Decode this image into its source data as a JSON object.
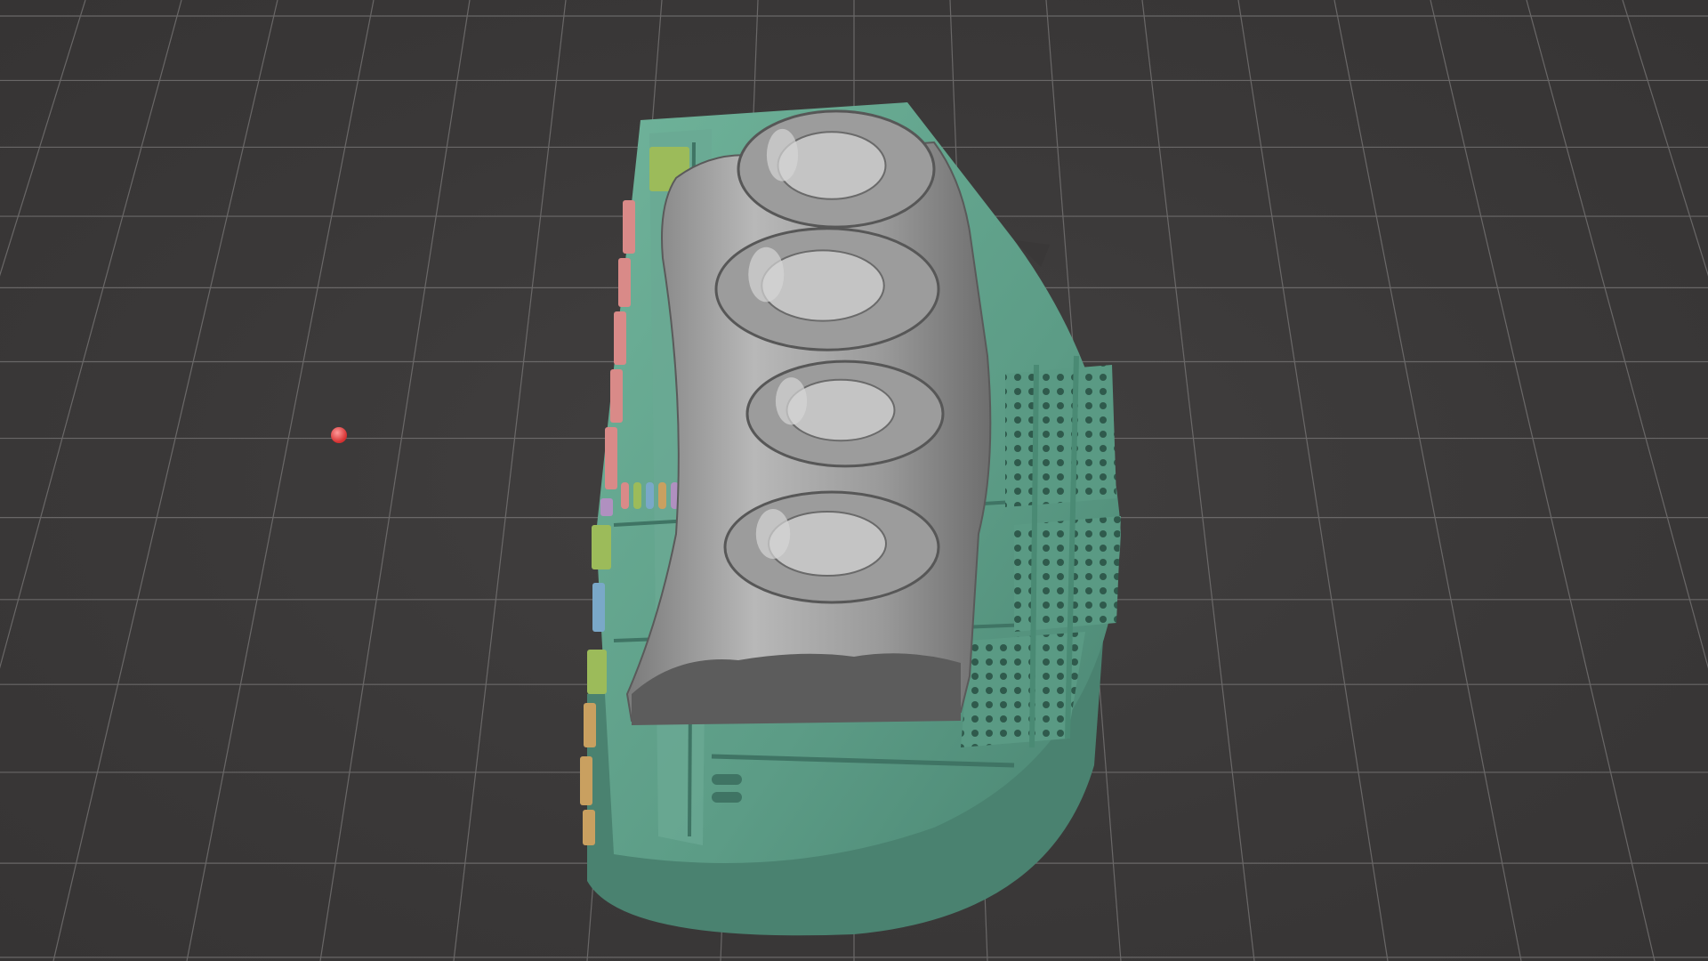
{
  "viewport": {
    "background_color": "#3a3838",
    "grid_color": "#7a7878",
    "grid_visible": true
  },
  "scene": {
    "pivot_marker_color": "#e84040",
    "model_base_color": "#5fa08a",
    "model_base_highlight": "#7cc0a6",
    "model_surface_color": "#a8a8a8",
    "model_surface_shadow": "#6a6a6a",
    "support_tab_colors": [
      "#d98a88",
      "#9cbb5a",
      "#7aa8c8",
      "#c9a060",
      "#b090c0"
    ]
  }
}
